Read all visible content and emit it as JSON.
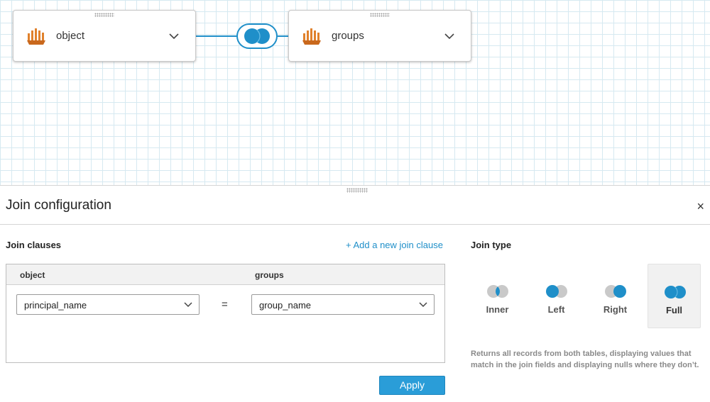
{
  "canvas": {
    "left_dataset": {
      "name": "object"
    },
    "right_dataset": {
      "name": "groups"
    },
    "join_node": {
      "type": "Full"
    }
  },
  "panel": {
    "title": "Join configuration",
    "close_glyph": "×",
    "join_clauses_label": "Join clauses",
    "add_clause_label": "+ Add a new join clause",
    "clause_header": {
      "left": "object",
      "right": "groups"
    },
    "clauses": [
      {
        "left_field": "principal_name",
        "operator": "=",
        "right_field": "group_name"
      }
    ],
    "apply_label": "Apply",
    "join_type_label": "Join type",
    "join_types": [
      {
        "label": "Inner",
        "selected": false
      },
      {
        "label": "Left",
        "selected": false
      },
      {
        "label": "Right",
        "selected": false
      },
      {
        "label": "Full",
        "selected": true
      }
    ],
    "join_type_description": "Returns all records from both tables, displaying values that match in the join fields and displaying nulls where they don’t."
  },
  "colors": {
    "accent": "#1f8fc9",
    "button": "#2a9dd8",
    "inactive": "#c9c9c9",
    "grid": "#d6e9f1",
    "dataset_icon": "#e0812c"
  },
  "icons": [
    "dataset-icon",
    "chevron-down-icon",
    "venn-full-icon",
    "drag-handle-icon",
    "close-icon"
  ]
}
